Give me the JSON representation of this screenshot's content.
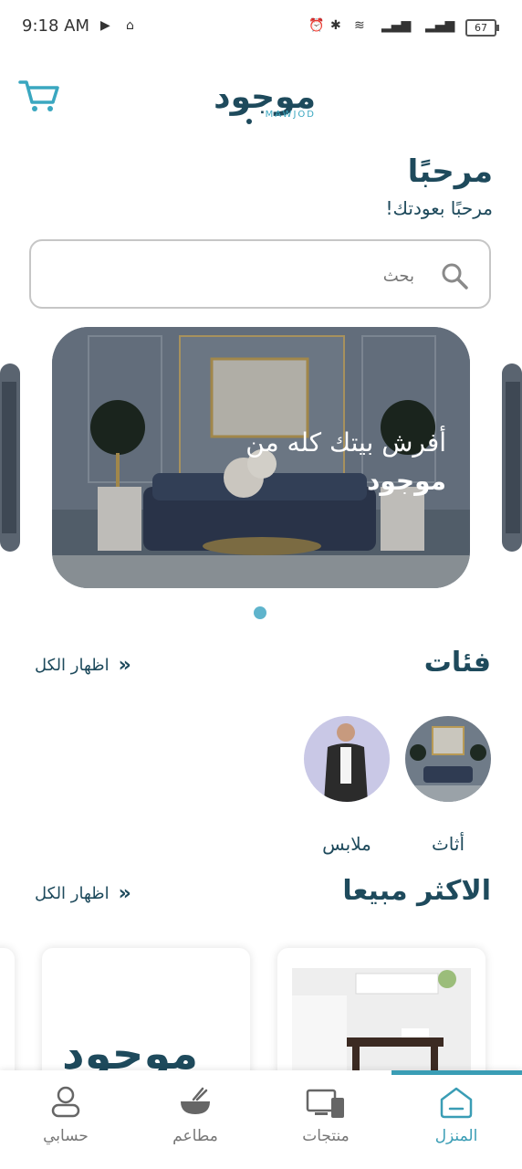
{
  "status_bar": {
    "time": "9:18 AM",
    "battery": "67"
  },
  "header": {
    "logo_text": "موجود",
    "logo_sub": "MAWJOD"
  },
  "greeting": {
    "title": "مرحبًا",
    "subtitle": "مرحبًا بعودتك!"
  },
  "search": {
    "placeholder": "بحث"
  },
  "banner": {
    "line1": "أفرش بيتك كله من",
    "line2": "موجود"
  },
  "categories": {
    "title": "فئات",
    "show_all": "اظهار الكل",
    "items": [
      {
        "label": "أثاث"
      },
      {
        "label": "ملابس"
      }
    ]
  },
  "best_sellers": {
    "title": "الاكثر مبيعا",
    "show_all": "اظهار الكل"
  },
  "bottom_nav": {
    "items": [
      {
        "label": "المنزل",
        "icon": "home-icon"
      },
      {
        "label": "منتجات",
        "icon": "products-icon"
      },
      {
        "label": "مطاعم",
        "icon": "restaurant-icon"
      },
      {
        "label": "حسابي",
        "icon": "user-icon"
      }
    ]
  },
  "colors": {
    "brand_dark": "#1e4a5c",
    "accent": "#3a9db5"
  }
}
